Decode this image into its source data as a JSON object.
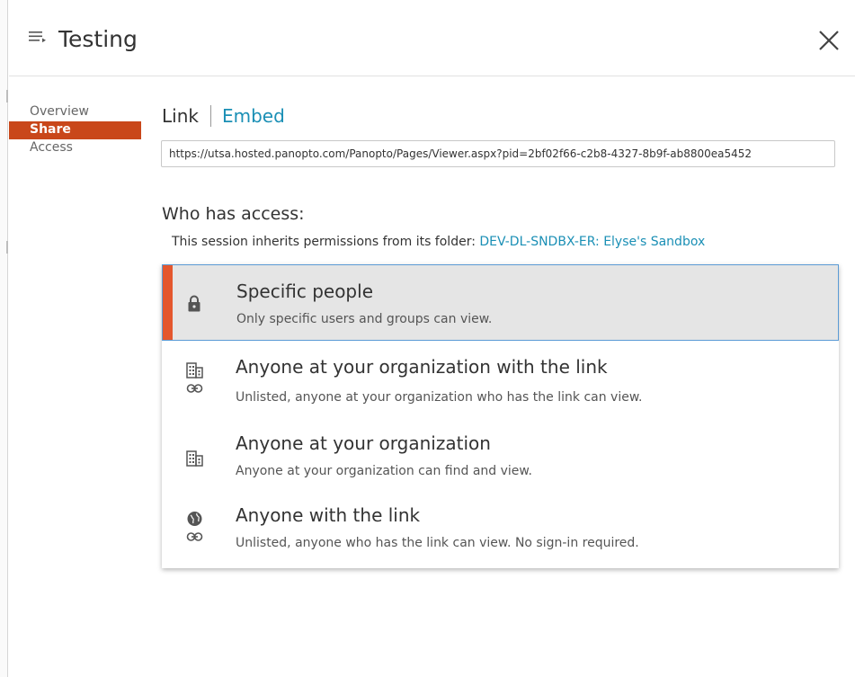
{
  "header": {
    "title": "Testing",
    "menu_icon": "list-menu-icon",
    "close_icon": "close-icon"
  },
  "sidebar": {
    "items": [
      {
        "label": "Overview",
        "active": false
      },
      {
        "label": "Share",
        "active": true
      },
      {
        "label": "Access",
        "active": false
      }
    ]
  },
  "share": {
    "tabs": [
      {
        "label": "Link",
        "active": true
      },
      {
        "label": "Embed",
        "active": false
      }
    ],
    "url_value": "https://utsa.hosted.panopto.com/Panopto/Pages/Viewer.aspx?pid=2bf02f66-c2b8-4327-8b9f-ab8800ea5452",
    "access_heading": "Who has access:",
    "inherit_text": "This session inherits permissions from its folder: ",
    "folder_link": "DEV-DL-SNDBX-ER: Elyse's Sandbox"
  },
  "access_options": [
    {
      "title": "Specific people",
      "description": "Only specific users and groups can view.",
      "icon": "lock-icon",
      "selected": true
    },
    {
      "title": "Anyone at your organization with the link",
      "description": "Unlisted, anyone at your organization who has the link can view.",
      "icon": "building-link-icon",
      "selected": false
    },
    {
      "title": "Anyone at your organization",
      "description": "Anyone at your organization can find and view.",
      "icon": "building-icon",
      "selected": false
    },
    {
      "title": "Anyone with the link",
      "description": "Unlisted, anyone who has the link can view. No sign-in required.",
      "icon": "globe-link-icon",
      "selected": false
    }
  ],
  "colors": {
    "accent_orange": "#c9471a",
    "selected_bar": "#e4572e",
    "link_blue": "#1a8fb5",
    "selected_border": "#5b9bd5"
  }
}
